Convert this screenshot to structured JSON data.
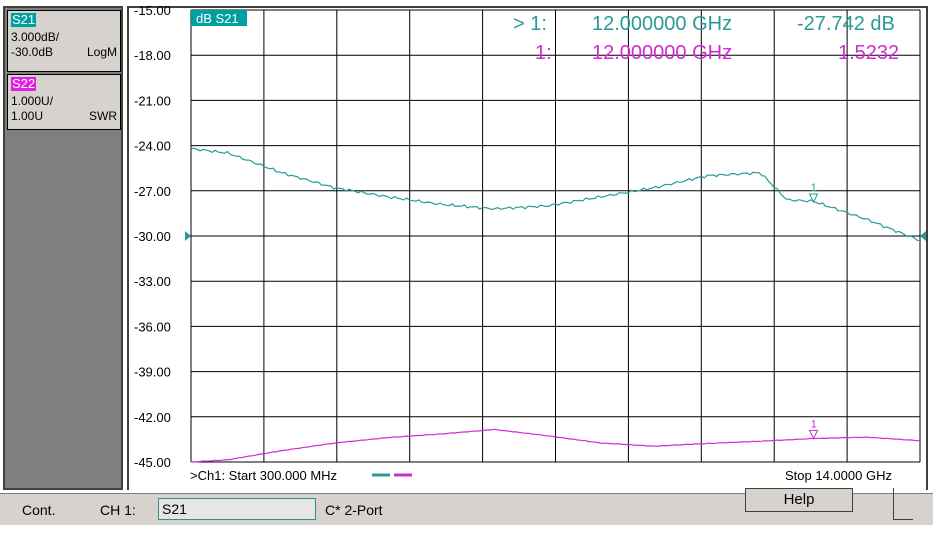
{
  "traces": [
    {
      "tag": "S21",
      "scale": "3.000dB/",
      "ref": "-30.0dB",
      "format": "LogM",
      "tag_bg": "#00a0a0",
      "color": "#2a9a96"
    },
    {
      "tag": "S22",
      "scale": "1.000U/",
      "ref": "1.00U",
      "format": "SWR",
      "tag_bg": "#e020e0",
      "color": "#d22ad2"
    }
  ],
  "plot": {
    "active_trace_label": "dB S21",
    "y_ticks": [
      "-15.00",
      "-18.00",
      "-21.00",
      "-24.00",
      "-27.00",
      "-30.00",
      "-33.00",
      "-36.00",
      "-39.00",
      "-42.00",
      "-45.00"
    ],
    "start_label": ">Ch1: Start  300.000 MHz",
    "stop_label": "Stop  14.0000 GHz",
    "marker_number": "1"
  },
  "markers": [
    {
      "prefix": "> 1:",
      "frequency": "12.000000 GHz",
      "value": "-27.742 dB",
      "color": "#2a9a96"
    },
    {
      "prefix": "1:",
      "frequency": "12.000000 GHz",
      "value": "1.5232",
      "color": "#d22ad2"
    }
  ],
  "status_bar": {
    "mode": "Cont.",
    "channel": "CH 1:",
    "measurement": "S21",
    "cal": "C* 2-Port",
    "help": "Help"
  },
  "chart_data": {
    "type": "line",
    "x_start_ghz": 0.3,
    "x_stop_ghz": 14.0,
    "ylim": [
      -45,
      -15
    ],
    "grid": true,
    "series": [
      {
        "name": "S21",
        "format": "LogM dB",
        "x": [
          0.3,
          1.0,
          2.0,
          3.0,
          4.0,
          5.0,
          6.0,
          7.0,
          8.0,
          9.0,
          10.0,
          11.0,
          11.5,
          12.0,
          13.0,
          14.0
        ],
        "values": [
          -24.2,
          -24.5,
          -25.8,
          -26.8,
          -27.4,
          -27.9,
          -28.2,
          -28.0,
          -27.4,
          -26.8,
          -26.0,
          -25.8,
          -27.6,
          -27.7,
          -28.9,
          -30.3
        ]
      },
      {
        "name": "S22",
        "format": "SWR",
        "x": [
          0.3,
          1.0,
          2.0,
          3.0,
          4.0,
          5.0,
          6.0,
          7.0,
          8.0,
          9.0,
          10.0,
          11.0,
          12.0,
          13.0,
          14.0
        ],
        "values": [
          1.0,
          1.05,
          1.25,
          1.42,
          1.54,
          1.62,
          1.72,
          1.58,
          1.42,
          1.35,
          1.41,
          1.46,
          1.52,
          1.55,
          1.47
        ]
      }
    ],
    "marker": {
      "x": 12.0,
      "s21_db": -27.742,
      "s22_swr": 1.5232
    }
  }
}
